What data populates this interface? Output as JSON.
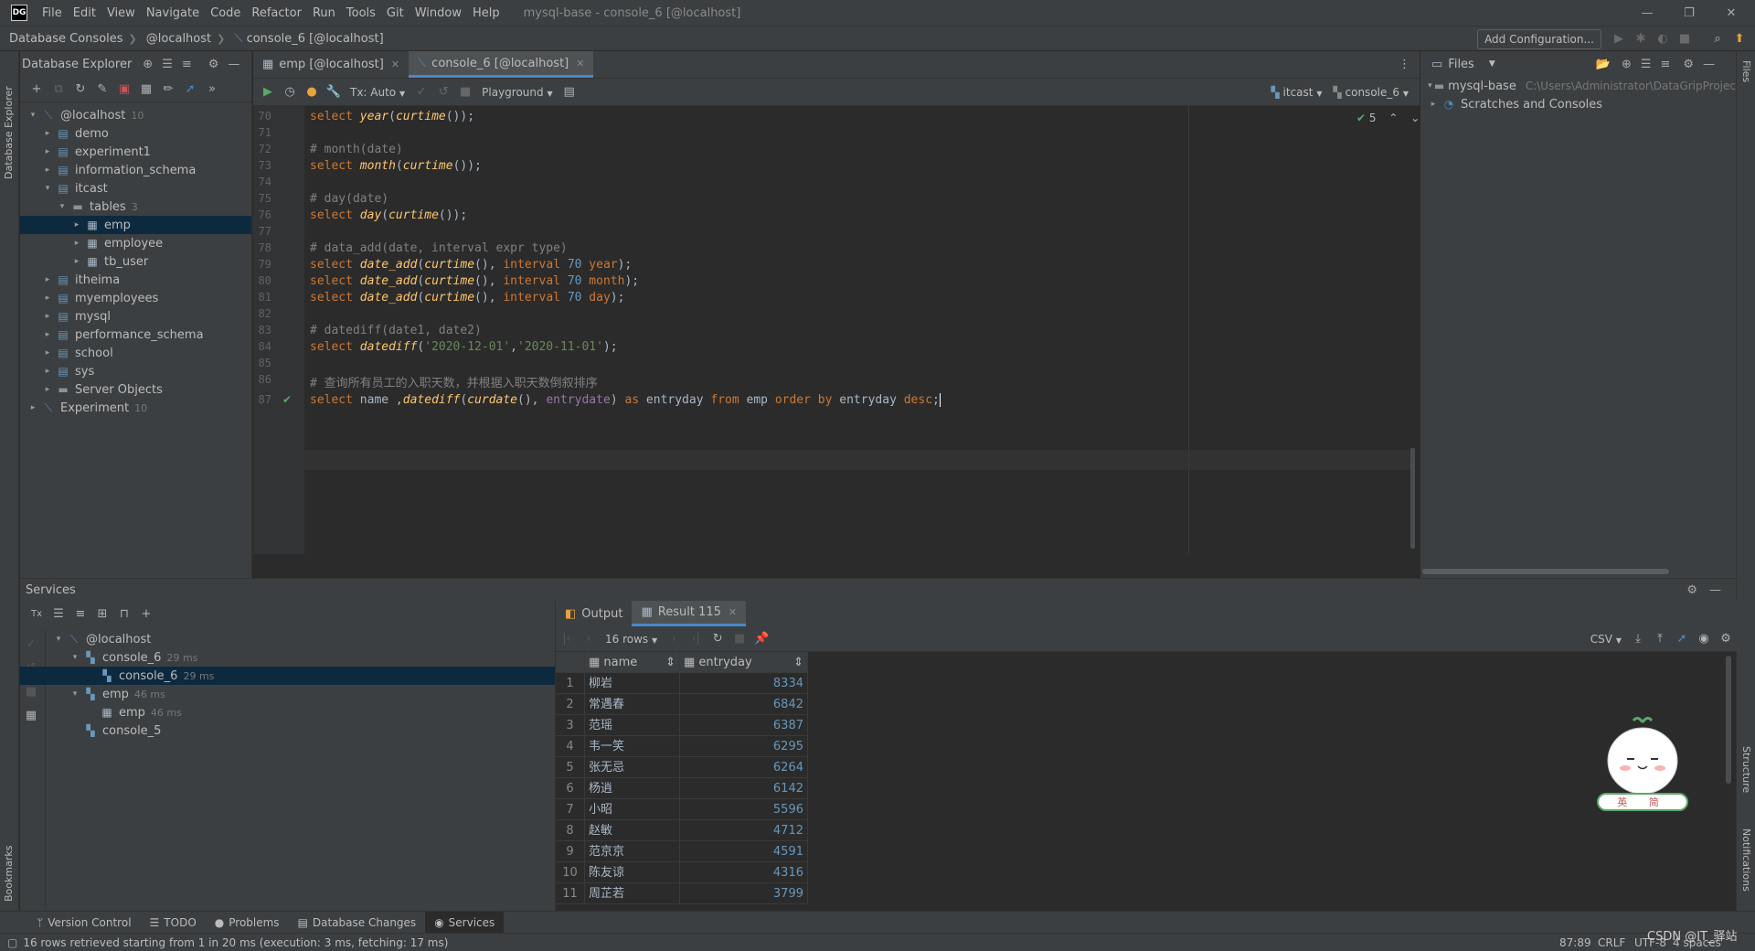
{
  "app": {
    "logo": "DG",
    "window_title": "mysql-base - console_6 [@localhost]",
    "menu": [
      "File",
      "Edit",
      "View",
      "Navigate",
      "Code",
      "Refactor",
      "Run",
      "Tools",
      "Git",
      "Window",
      "Help"
    ]
  },
  "navbar": {
    "crumbs": [
      "Database Consoles",
      "@localhost",
      "console_6 [@localhost]"
    ],
    "add_configuration": "Add Configuration..."
  },
  "left_stripe": {
    "database_explorer": "Database Explorer",
    "bookmarks": "Bookmarks"
  },
  "right_stripe": {
    "files": "Files",
    "structure": "Structure",
    "notifications": "Notifications"
  },
  "db_explorer": {
    "title": "Database Explorer",
    "tree": [
      {
        "label": "@localhost",
        "count": "10",
        "icon": "host-icon",
        "arrow": "▾",
        "indent": 0
      },
      {
        "label": "demo",
        "count": "",
        "icon": "database-icon",
        "arrow": "▸",
        "indent": 1
      },
      {
        "label": "experiment1",
        "count": "",
        "icon": "database-icon",
        "arrow": "▸",
        "indent": 1
      },
      {
        "label": "information_schema",
        "count": "",
        "icon": "database-icon",
        "arrow": "▸",
        "indent": 1
      },
      {
        "label": "itcast",
        "count": "",
        "icon": "database-icon",
        "arrow": "▾",
        "indent": 1
      },
      {
        "label": "tables",
        "count": "3",
        "icon": "folder-icon",
        "arrow": "▾",
        "indent": 2
      },
      {
        "label": "emp",
        "count": "",
        "icon": "table-icon",
        "arrow": "▸",
        "indent": 3,
        "selected": true
      },
      {
        "label": "employee",
        "count": "",
        "icon": "table-icon",
        "arrow": "▸",
        "indent": 3
      },
      {
        "label": "tb_user",
        "count": "",
        "icon": "table-icon",
        "arrow": "▸",
        "indent": 3
      },
      {
        "label": "itheima",
        "count": "",
        "icon": "database-icon",
        "arrow": "▸",
        "indent": 1
      },
      {
        "label": "myemployees",
        "count": "",
        "icon": "database-icon",
        "arrow": "▸",
        "indent": 1
      },
      {
        "label": "mysql",
        "count": "",
        "icon": "database-icon",
        "arrow": "▸",
        "indent": 1
      },
      {
        "label": "performance_schema",
        "count": "",
        "icon": "database-icon",
        "arrow": "▸",
        "indent": 1
      },
      {
        "label": "school",
        "count": "",
        "icon": "database-icon",
        "arrow": "▸",
        "indent": 1
      },
      {
        "label": "sys",
        "count": "",
        "icon": "database-icon",
        "arrow": "▸",
        "indent": 1
      },
      {
        "label": "Server Objects",
        "count": "",
        "icon": "folder-icon",
        "arrow": "▸",
        "indent": 1
      },
      {
        "label": "Experiment",
        "count": "10",
        "icon": "host-icon",
        "arrow": "▸",
        "indent": 0
      }
    ]
  },
  "editor": {
    "tabs": [
      {
        "label": "emp [@localhost]",
        "active": false
      },
      {
        "label": "console_6 [@localhost]",
        "active": true
      }
    ],
    "toolbar": {
      "tx": "Tx: Auto",
      "playground": "Playground",
      "schema": "itcast",
      "session": "console_6"
    },
    "inspection_count": "5",
    "lines": [
      {
        "n": "70",
        "code": [
          [
            "kw",
            "select "
          ],
          [
            "fn",
            "year"
          ],
          [
            "ident",
            "("
          ],
          [
            "fn",
            "curtime"
          ],
          [
            "ident",
            "());"
          ]
        ]
      },
      {
        "n": "71",
        "code": []
      },
      {
        "n": "72",
        "code": [
          [
            "cm",
            "# month(date)"
          ]
        ]
      },
      {
        "n": "73",
        "code": [
          [
            "kw",
            "select "
          ],
          [
            "fn",
            "month"
          ],
          [
            "ident",
            "("
          ],
          [
            "fn",
            "curtime"
          ],
          [
            "ident",
            "());"
          ]
        ]
      },
      {
        "n": "74",
        "code": []
      },
      {
        "n": "75",
        "code": [
          [
            "cm",
            "# day(date)"
          ]
        ]
      },
      {
        "n": "76",
        "code": [
          [
            "kw",
            "select "
          ],
          [
            "fn",
            "day"
          ],
          [
            "ident",
            "("
          ],
          [
            "fn",
            "curtime"
          ],
          [
            "ident",
            "());"
          ]
        ]
      },
      {
        "n": "77",
        "code": []
      },
      {
        "n": "78",
        "code": [
          [
            "cm",
            "# data_add(date, interval expr type)"
          ]
        ]
      },
      {
        "n": "79",
        "code": [
          [
            "kw",
            "select "
          ],
          [
            "fn",
            "date_add"
          ],
          [
            "ident",
            "("
          ],
          [
            "fn",
            "curtime"
          ],
          [
            "ident",
            "(), "
          ],
          [
            "kw",
            "interval "
          ],
          [
            "num",
            "70 "
          ],
          [
            "kw",
            "year"
          ],
          [
            "ident",
            ");"
          ]
        ]
      },
      {
        "n": "80",
        "code": [
          [
            "kw",
            "select "
          ],
          [
            "fn",
            "date_add"
          ],
          [
            "ident",
            "("
          ],
          [
            "fn",
            "curtime"
          ],
          [
            "ident",
            "(), "
          ],
          [
            "kw",
            "interval "
          ],
          [
            "num",
            "70 "
          ],
          [
            "kw",
            "month"
          ],
          [
            "ident",
            ");"
          ]
        ]
      },
      {
        "n": "81",
        "code": [
          [
            "kw",
            "select "
          ],
          [
            "fn",
            "date_add"
          ],
          [
            "ident",
            "("
          ],
          [
            "fn",
            "curtime"
          ],
          [
            "ident",
            "(), "
          ],
          [
            "kw",
            "interval "
          ],
          [
            "num",
            "70 "
          ],
          [
            "kw",
            "day"
          ],
          [
            "ident",
            ");"
          ]
        ]
      },
      {
        "n": "82",
        "code": []
      },
      {
        "n": "83",
        "code": [
          [
            "cm",
            "# datediff(date1, date2)"
          ]
        ]
      },
      {
        "n": "84",
        "code": [
          [
            "kw",
            "select "
          ],
          [
            "fn",
            "datediff"
          ],
          [
            "ident",
            "("
          ],
          [
            "str",
            "'2020-12-01'"
          ],
          [
            "ident",
            ","
          ],
          [
            "str",
            "'2020-11-01'"
          ],
          [
            "ident",
            ");"
          ]
        ]
      },
      {
        "n": "85",
        "code": []
      },
      {
        "n": "86",
        "code": [
          [
            "cm",
            "# 查询所有员工的入职天数，并根据入职天数倒叙排序"
          ]
        ]
      },
      {
        "n": "87",
        "code": [
          [
            "kw",
            "select "
          ],
          [
            "ident",
            "name ,"
          ],
          [
            "fn",
            "datediff"
          ],
          [
            "ident",
            "("
          ],
          [
            "fn",
            "curdate"
          ],
          [
            "ident",
            "(), "
          ],
          [
            "pu",
            "entrydate"
          ],
          [
            "ident",
            ") "
          ],
          [
            "kw",
            "as "
          ],
          [
            "ident",
            "entryday "
          ],
          [
            "kw",
            "from "
          ],
          [
            "ident",
            "emp "
          ],
          [
            "kw",
            "order by "
          ],
          [
            "ident",
            "entryday "
          ],
          [
            "kw",
            "desc"
          ],
          [
            "ident",
            ";"
          ]
        ]
      }
    ]
  },
  "files_panel": {
    "title": "Files",
    "items": [
      {
        "label": "mysql-base",
        "path": "C:\\Users\\Administrator\\DataGripProjec"
      },
      {
        "label": "Scratches and Consoles",
        "path": ""
      }
    ]
  },
  "services": {
    "title": "Services",
    "tree": [
      {
        "label": "@localhost",
        "time": "",
        "indent": 0,
        "arrow": "▾",
        "icon": "host-icon"
      },
      {
        "label": "console_6",
        "time": "29 ms",
        "indent": 1,
        "arrow": "▾",
        "icon": "console-icon"
      },
      {
        "label": "console_6",
        "time": "29 ms",
        "indent": 2,
        "arrow": "",
        "icon": "console-icon",
        "selected": true
      },
      {
        "label": "emp",
        "time": "46 ms",
        "indent": 1,
        "arrow": "▾",
        "icon": "console-icon"
      },
      {
        "label": "emp",
        "time": "46 ms",
        "indent": 2,
        "arrow": "",
        "icon": "table-icon"
      },
      {
        "label": "console_5",
        "time": "",
        "indent": 1,
        "arrow": "",
        "icon": "console-icon"
      }
    ],
    "result_tabs": [
      {
        "label": "Output"
      },
      {
        "label": "Result 115"
      }
    ],
    "rows_label": "16 rows",
    "export_format": "CSV",
    "columns": [
      "name",
      "entryday"
    ],
    "rows": [
      {
        "n": "1",
        "name": "柳岩",
        "entryday": "8334"
      },
      {
        "n": "2",
        "name": "常遇春",
        "entryday": "6842"
      },
      {
        "n": "3",
        "name": "范瑶",
        "entryday": "6387"
      },
      {
        "n": "4",
        "name": "韦一笑",
        "entryday": "6295"
      },
      {
        "n": "5",
        "name": "张无忌",
        "entryday": "6264"
      },
      {
        "n": "6",
        "name": "杨逍",
        "entryday": "6142"
      },
      {
        "n": "7",
        "name": "小昭",
        "entryday": "5596"
      },
      {
        "n": "8",
        "name": "赵敏",
        "entryday": "4712"
      },
      {
        "n": "9",
        "name": "范京京",
        "entryday": "4591"
      },
      {
        "n": "10",
        "name": "陈友谅",
        "entryday": "4316"
      },
      {
        "n": "11",
        "name": "周芷若",
        "entryday": "3799"
      }
    ]
  },
  "tool_windows": [
    "Version Control",
    "TODO",
    "Problems",
    "Database Changes",
    "Services"
  ],
  "status": {
    "message": "16 rows retrieved starting from 1 in 20 ms (execution: 3 ms, fetching: 17 ms)",
    "position": "87:89",
    "line_sep": "CRLF",
    "encoding": "UTF-8",
    "indent": "4 spaces",
    "watermark": "CSDN @IT_驿站"
  },
  "mascot": {
    "sign": "英 简"
  },
  "colors": {
    "keyword": "#cc7832",
    "function": "#ffc66d",
    "number": "#6897bb",
    "string": "#6a8759",
    "comment": "#808080",
    "accent": "#4a88c7",
    "selection": "#0d293e"
  }
}
